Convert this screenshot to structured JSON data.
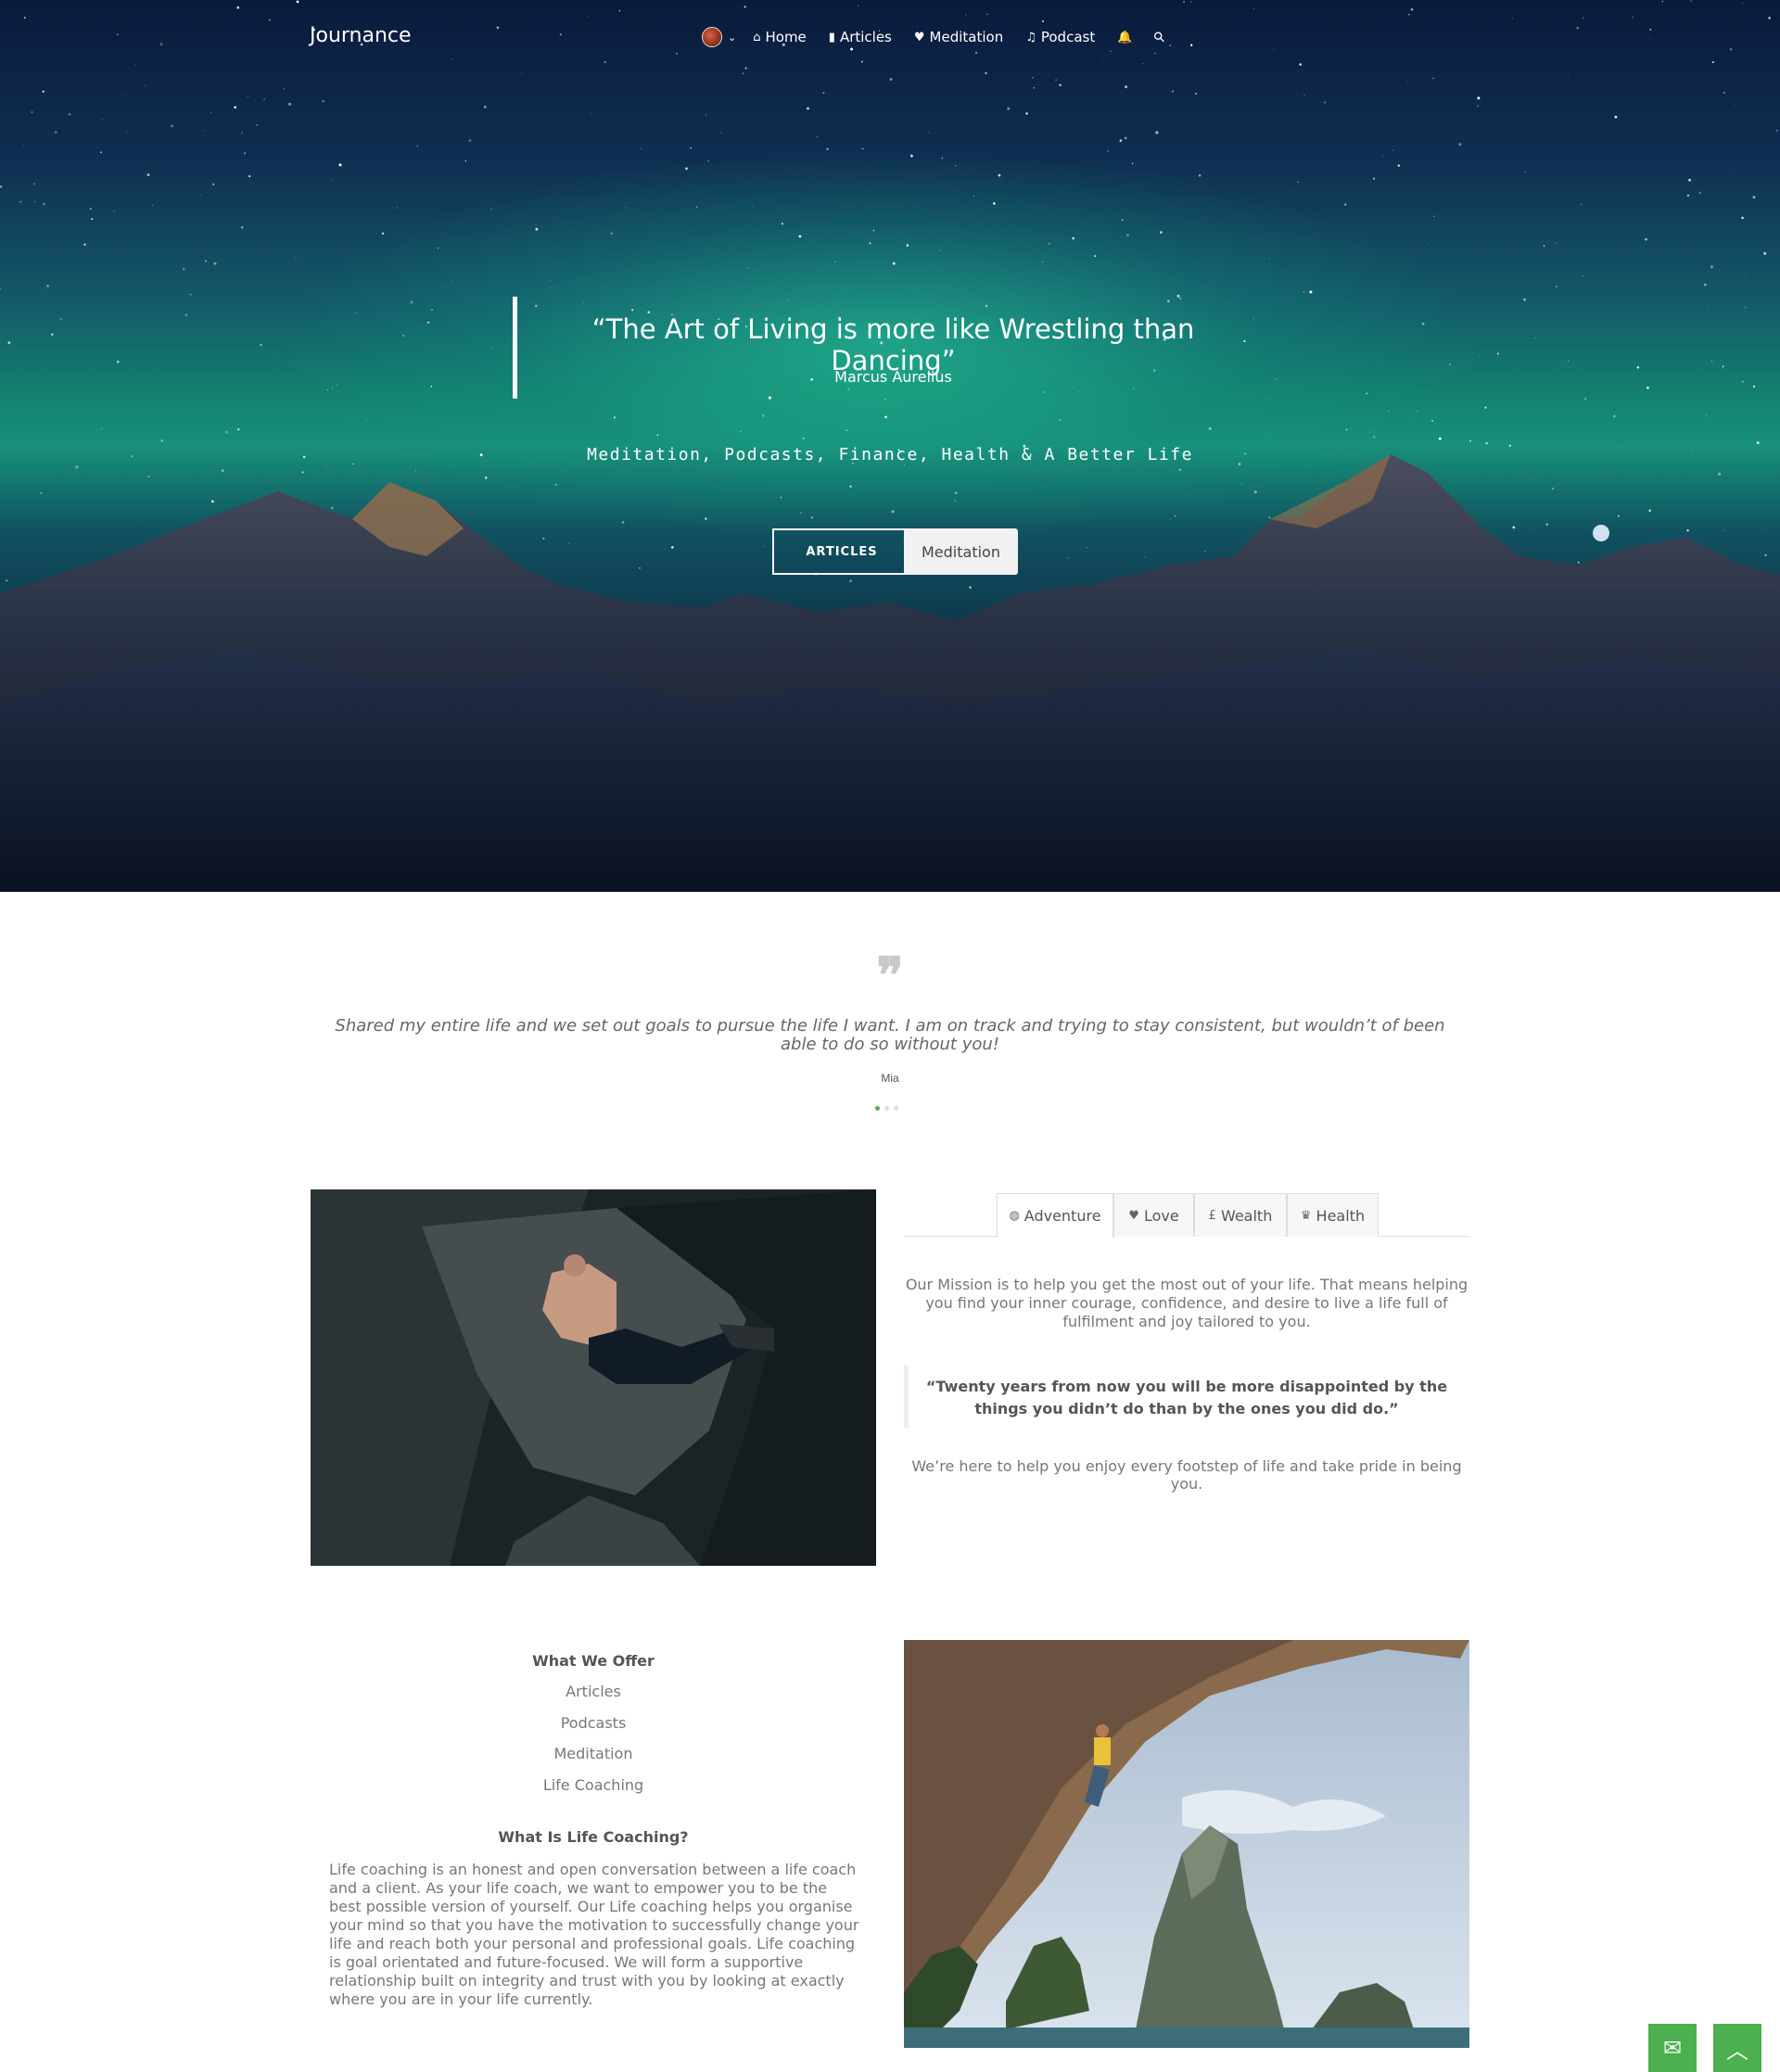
{
  "nav": {
    "brand": "Journance",
    "items": [
      {
        "icon": "home-icon",
        "glyph": "⌂",
        "label": "Home"
      },
      {
        "icon": "book-icon",
        "glyph": "▮",
        "label": "Articles"
      },
      {
        "icon": "heart-icon",
        "glyph": "♥",
        "label": "Meditation"
      },
      {
        "icon": "music-icon",
        "glyph": "♫",
        "label": "Podcast"
      }
    ],
    "bell_glyph": "🔔",
    "search_glyph": "⚲",
    "chevron_glyph": "⌄"
  },
  "hero": {
    "quote": "“The Art of Living is more like Wrestling than Dancing”",
    "author": "Marcus Aurelius",
    "tagline": "Meditation, Podcasts, Finance, Health & A Better Life",
    "btn_articles": "ARTICLES",
    "btn_meditation": "Meditation"
  },
  "testimonial": {
    "quote_glyph": "❞",
    "text": "Shared my entire life and we set out goals to pursue the life I want. I am on track and trying to stay consistent, but wouldn’t of been able to do so without you!",
    "author": "Mia",
    "slide_count": 3,
    "active_slide": 0
  },
  "tabs": [
    {
      "icon": "globe-icon",
      "glyph": "◍",
      "label": "Adventure",
      "active": true
    },
    {
      "icon": "heart-icon",
      "glyph": "♥",
      "label": "Love",
      "active": false
    },
    {
      "icon": "pound-icon",
      "glyph": "£",
      "label": "Wealth",
      "active": false
    },
    {
      "icon": "trophy-icon",
      "glyph": "♛",
      "label": "Health",
      "active": false
    }
  ],
  "adventure": {
    "mission": "Our Mission is to help you get the most out of your life. That means helping you find your inner courage, confidence, and desire to live a life full of fulfilment and joy tailored to you.",
    "blockquote": "“Twenty years from now you will be more disappointed by the things you didn’t do than by the ones you did do.”",
    "footstep": "We’re here to help you enjoy every footstep of life and take pride in being you."
  },
  "offer": {
    "heading": "What We Offer",
    "items": [
      "Articles",
      "Podcasts",
      "Meditation",
      "Life Coaching"
    ],
    "whatis_heading": "What Is Life Coaching?",
    "whatis_text": "Life coaching is an honest and open conversation between a life coach and a client. As your life coach, we want to empower you to be the best possible version of yourself. Our Life coaching helps you organise your mind so that you have the motivation to successfully change your life and reach both your personal and professional goals. Life coaching is goal orientated and future-focused. We will form a supportive relationship built on integrity and trust with you by looking at exactly where you are in your life currently."
  },
  "fab": {
    "mail_glyph": "✉",
    "top_glyph": "︿"
  },
  "colors": {
    "accent": "#4caf50"
  }
}
